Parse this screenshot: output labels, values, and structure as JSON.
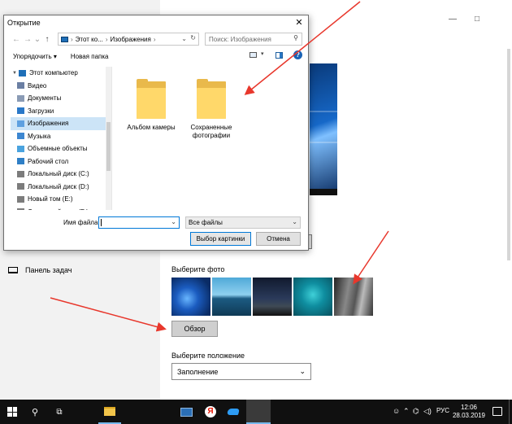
{
  "dialog": {
    "title": "Открытие",
    "close_glyph": "✕",
    "nav": {
      "back": "←",
      "forward": "→",
      "recent": "⌄",
      "up": "↑"
    },
    "address": {
      "segments": [
        "Этот ко...",
        "Изображения"
      ],
      "sep": "›",
      "dropdown": "⌄",
      "refresh": "↻"
    },
    "search_placeholder": "Поиск: Изображения",
    "search_glyph": "⚲",
    "toolbar": {
      "organize": "Упорядочить ▾",
      "new_folder": "Новая папка",
      "view_dropdown": "▾",
      "help": "?"
    },
    "nav_tree": [
      {
        "label": "Этот компьютер",
        "icon": "computer-icon",
        "color": "#1f6fb8"
      },
      {
        "label": "Видео",
        "icon": "video-folder-icon",
        "color": "#6b7fa3"
      },
      {
        "label": "Документы",
        "icon": "documents-folder-icon",
        "color": "#8a9bb5"
      },
      {
        "label": "Загрузки",
        "icon": "downloads-folder-icon",
        "color": "#2a78c8"
      },
      {
        "label": "Изображения",
        "icon": "pictures-folder-icon",
        "color": "#5ea0e0",
        "selected": true
      },
      {
        "label": "Музыка",
        "icon": "music-folder-icon",
        "color": "#3d87d1"
      },
      {
        "label": "Объемные объекты",
        "icon": "3d-objects-icon",
        "color": "#4aa3df"
      },
      {
        "label": "Рабочий стол",
        "icon": "desktop-folder-icon",
        "color": "#2f7fc6"
      },
      {
        "label": "Локальный диск (C:)",
        "icon": "drive-icon",
        "color": "#7c7c7c"
      },
      {
        "label": "Локальный диск (D:)",
        "icon": "drive-icon",
        "color": "#7c7c7c"
      },
      {
        "label": "Новый том (E:)",
        "icon": "drive-icon",
        "color": "#7c7c7c"
      },
      {
        "label": "Локальный диск (F:)",
        "icon": "drive-icon",
        "color": "#7c7c7c"
      }
    ],
    "folders": [
      {
        "name": "Альбом камеры"
      },
      {
        "name": "Сохраненные фотографии"
      }
    ],
    "filename_label": "Имя файла:",
    "filename_value": "",
    "filter_value": "Все файлы",
    "dropdown_glyph": "⌄",
    "select_button": "Выбор картинки",
    "cancel_button": "Отмена"
  },
  "settings": {
    "window_controls": {
      "minimize": "—",
      "maximize": "□"
    },
    "taskbar_item": "Панель задач",
    "choose_photo": "Выберите фото",
    "browse_button": "Обзор",
    "choose_fit": "Выберите положение",
    "fit_value": "Заполнение",
    "fit_dropdown": "⌄"
  },
  "taskbar": {
    "search_glyph": "⚲",
    "taskview_glyph": "⧉",
    "yandex_letter": "Я",
    "tray": {
      "people": "☺",
      "chevron": "⌃",
      "network": "⌬",
      "volume": "◁)",
      "lang": "РУС"
    },
    "time": "12:06",
    "date": "28.03.2019"
  },
  "colors": {
    "accent": "#0078d7",
    "arrow": "#e8372c",
    "folder": "#ffd86a",
    "taskbar": "#101010"
  }
}
